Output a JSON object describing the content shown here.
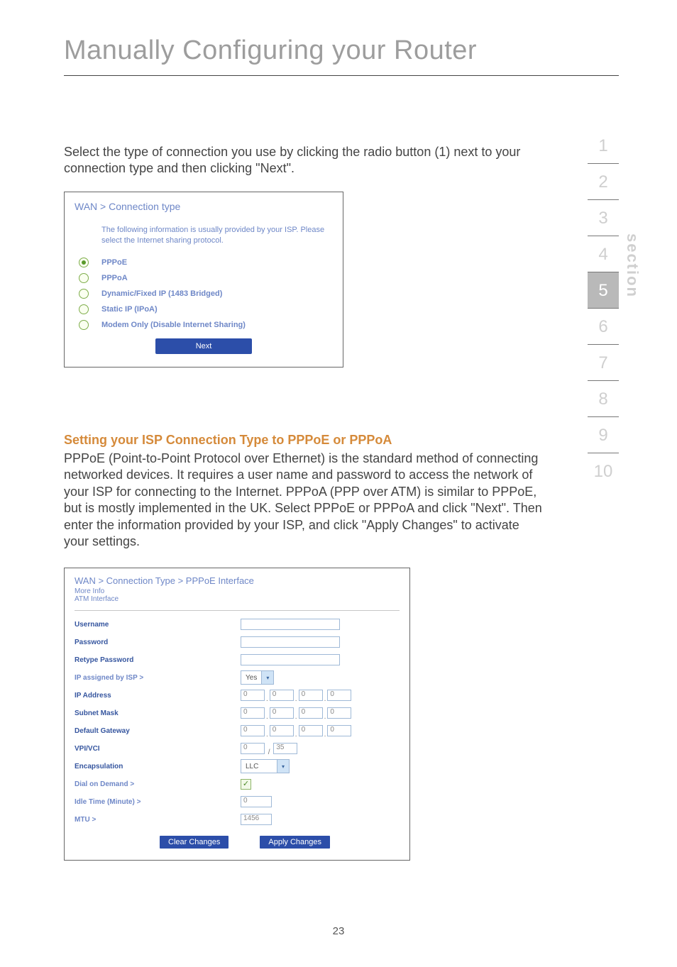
{
  "page_number": "23",
  "title": "Manually Configuring your Router",
  "intro_text": "Select the type of connection you use by clicking the radio button (1) next to your connection type and then clicking \"Next\".",
  "subhead": "Setting your ISP Connection Type to PPPoE or PPPoA",
  "para2": "PPPoE (Point-to-Point Protocol over Ethernet) is the standard method of connecting networked devices. It requires a user name and password to access the network of your ISP for connecting to the Internet. PPPoA (PPP over ATM) is similar to PPPoE, but is mostly implemented in the UK. Select PPPoE or PPPoA and click \"Next\". Then enter the information provided by your ISP, and click \"Apply Changes\" to activate your settings.",
  "side_nav": {
    "label": "section",
    "items": [
      "1",
      "2",
      "3",
      "4",
      "5",
      "6",
      "7",
      "8",
      "9",
      "10"
    ],
    "active_index": 4
  },
  "shot1": {
    "breadcrumb": "WAN > Connection type",
    "desc": "The following information is usually provided by your ISP. Please select the Internet sharing protocol.",
    "options": [
      {
        "label": "PPPoE",
        "selected": true
      },
      {
        "label": "PPPoA",
        "selected": false
      },
      {
        "label": "Dynamic/Fixed IP (1483 Bridged)",
        "selected": false
      },
      {
        "label": "Static IP (IPoA)",
        "selected": false
      },
      {
        "label": "Modem Only (Disable Internet Sharing)",
        "selected": false
      }
    ],
    "next_label": "Next"
  },
  "shot2": {
    "breadcrumb": "WAN > Connection Type > PPPoE Interface",
    "more_info": "More Info",
    "atm_interface": "ATM Interface",
    "fields": {
      "username_label": "Username",
      "password_label": "Password",
      "retype_password_label": "Retype Password",
      "ip_assigned_label": "IP assigned by ISP >",
      "ip_assigned_value": "Yes",
      "ip_address_label": "IP Address",
      "ip_address": [
        "0",
        "0",
        "0",
        "0"
      ],
      "subnet_mask_label": "Subnet Mask",
      "subnet_mask": [
        "0",
        "0",
        "0",
        "0"
      ],
      "default_gateway_label": "Default Gateway",
      "default_gateway": [
        "0",
        "0",
        "0",
        "0"
      ],
      "vpi_vci_label": "VPI/VCI",
      "vpi": "0",
      "vci": "35",
      "encapsulation_label": "Encapsulation",
      "encapsulation_value": "LLC",
      "dial_on_demand_label": "Dial on Demand >",
      "dial_on_demand_checked": true,
      "idle_time_label": "Idle Time (Minute) >",
      "idle_time_value": "0",
      "mtu_label": "MTU >",
      "mtu_value": "1456"
    },
    "clear_btn": "Clear Changes",
    "apply_btn": "Apply Changes"
  }
}
